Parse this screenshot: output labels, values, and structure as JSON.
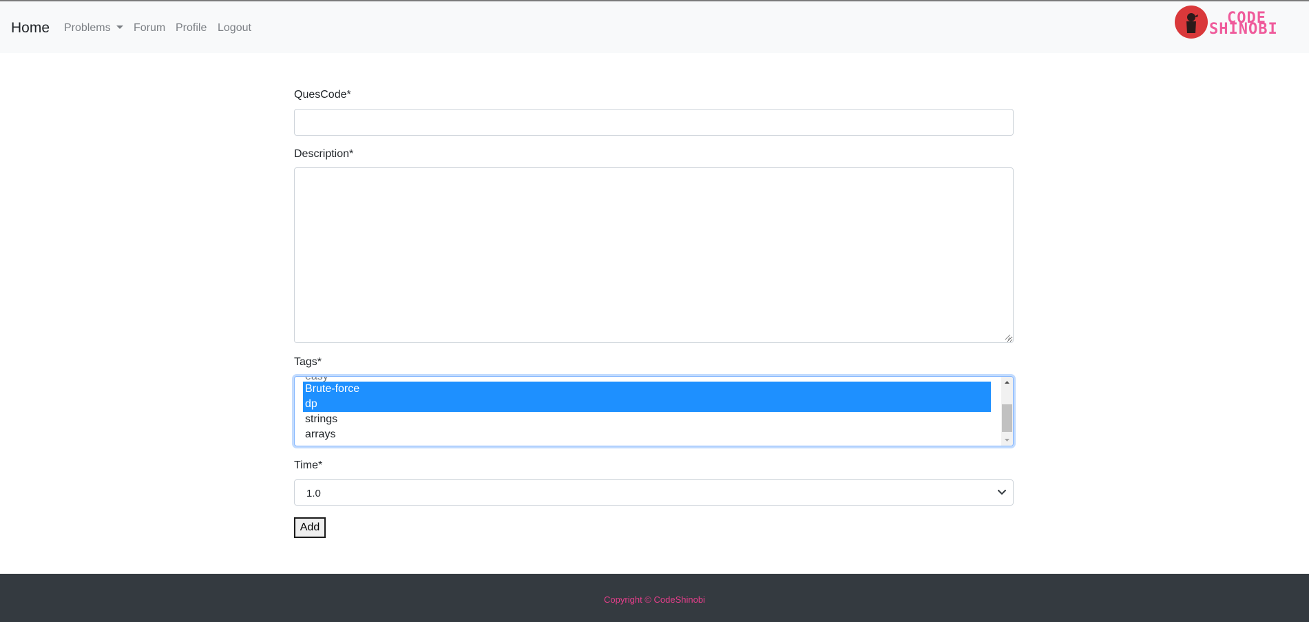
{
  "navbar": {
    "brand": "Home",
    "items": [
      {
        "label": "Problems",
        "has_dropdown": true
      },
      {
        "label": "Forum"
      },
      {
        "label": "Profile"
      },
      {
        "label": "Logout"
      }
    ],
    "logo": {
      "line1": "CODE",
      "line2": "SHINOBI"
    }
  },
  "form": {
    "quescode_label": "QuesCode*",
    "quescode_value": "",
    "description_label": "Description*",
    "description_value": "",
    "tags_label": "Tags*",
    "tags_options": [
      {
        "label": "easy",
        "selected": false,
        "partially_visible": true
      },
      {
        "label": "Brute-force",
        "selected": true
      },
      {
        "label": "dp",
        "selected": true
      },
      {
        "label": "strings",
        "selected": false
      },
      {
        "label": "arrays",
        "selected": false
      }
    ],
    "time_label": "Time*",
    "time_value": "1.0",
    "submit_label": "Add"
  },
  "footer": {
    "copyright": "Copyright © CodeShinobi"
  },
  "colors": {
    "navbar_bg": "#f8f9fa",
    "selection": "#1e90ff",
    "footer_bg": "#343a40",
    "footer_text": "#e83e8c",
    "logo_red": "#d9383a",
    "logo_pink": "#ef5b9b"
  }
}
